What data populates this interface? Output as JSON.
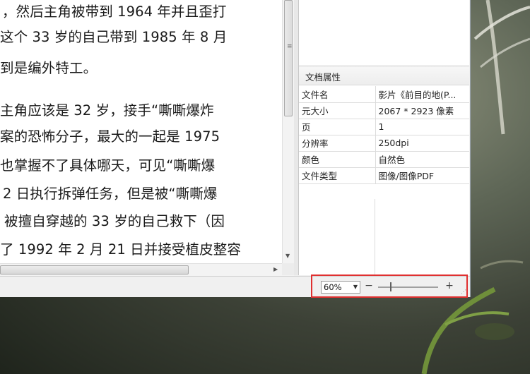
{
  "document": {
    "lines": [
      "，然后主角被带到 1964 年并且歪打",
      "这个 33 岁的自己带到 1985 年 8 月",
      "到是编外特工。",
      "主角应该是 32 岁，接手“嘶嘶爆炸",
      "案的恐怖分子，最大的一起是 1975",
      "也掌握不了具体哪天，可见“嘶嘶爆",
      "2 日执行拆弹任务，但是被“嘶嘶爆",
      "被擅自穿越的 33 岁的自己救下（因",
      "了 1992 年 2 月 21 日并接受植皮整容"
    ]
  },
  "properties": {
    "header": "文档属性",
    "rows": [
      {
        "key": "文件名",
        "value": "影片《前目的地(P..."
      },
      {
        "key": "元大小",
        "value": "2067 * 2923 像素"
      },
      {
        "key": "页",
        "value": "1"
      },
      {
        "key": "分辨率",
        "value": "250dpi"
      },
      {
        "key": "颜色",
        "value": "自然色"
      },
      {
        "key": "文件类型",
        "value": "图像/图像PDF"
      }
    ]
  },
  "status_bar": {
    "zoom_value": "60%",
    "zoom_minus": "−",
    "zoom_plus": "+",
    "zoom_slider_level_percent": 20
  },
  "icons": {
    "dropdown": "chevron-down-icon",
    "scroll_down": "arrow-down-icon",
    "scroll_right": "arrow-right-icon",
    "grip": "resize-grip-icon"
  },
  "colors": {
    "highlight_border": "#e03030",
    "window_bg": "#f0f0f0"
  }
}
